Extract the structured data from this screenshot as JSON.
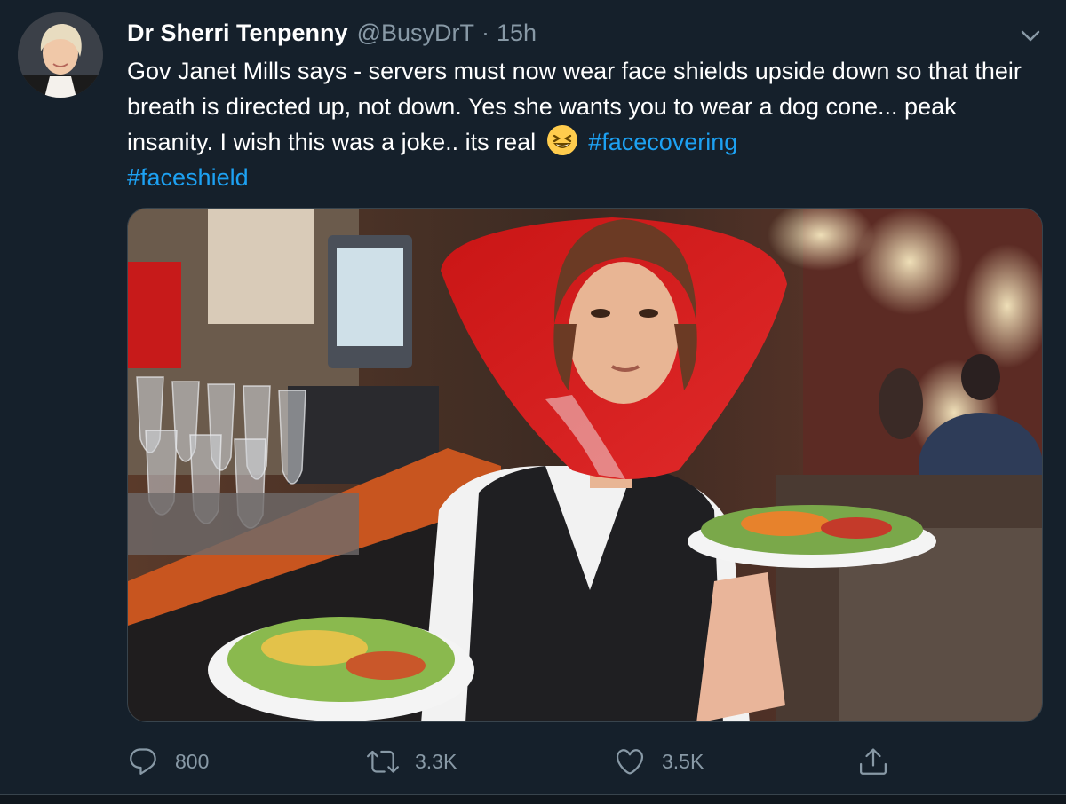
{
  "tweet": {
    "author_name": "Dr Sherri Tenpenny",
    "handle": "@BusyDrT",
    "separator": "·",
    "time": "15h",
    "text_parts": {
      "line1": "Gov Janet Mills says - servers must now wear face shields upside down so that their breath is directed up, not down. Yes she wants you to wear a dog cone... peak insanity.  I wish this was a joke.. its real ",
      "hashtag1": "#facecovering",
      "hashtag2": "#faceshield"
    },
    "emoji": "grinning-squinting-face-emoji",
    "media_description_icon": "photo",
    "actions": {
      "replies": "800",
      "retweets": "3.3K",
      "likes": "3.5K"
    }
  },
  "icons": {
    "caret": "chevron-down-icon",
    "reply": "reply-icon",
    "retweet": "retweet-icon",
    "like": "heart-icon",
    "share": "share-icon"
  },
  "colors": {
    "background": "#15202b",
    "text": "#ffffff",
    "secondary": "#8899a6",
    "link": "#1da1f2",
    "cone_red": "#d81d1d"
  }
}
